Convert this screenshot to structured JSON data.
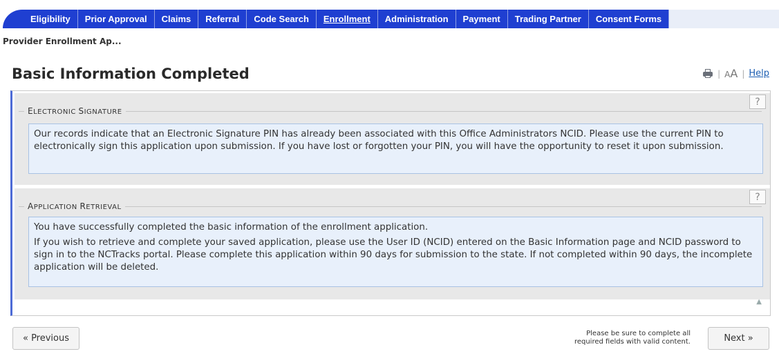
{
  "nav": {
    "tabs": [
      {
        "label": "Eligibility"
      },
      {
        "label": "Prior Approval"
      },
      {
        "label": "Claims"
      },
      {
        "label": "Referral"
      },
      {
        "label": "Code Search"
      },
      {
        "label": "Enrollment"
      },
      {
        "label": "Administration"
      },
      {
        "label": "Payment"
      },
      {
        "label": "Trading Partner"
      },
      {
        "label": "Consent Forms"
      }
    ],
    "active": "Enrollment"
  },
  "breadcrumb": "Provider Enrollment Ap...",
  "page": {
    "title": "Basic Information Completed",
    "text_size_label": "AA",
    "help_label": "Help"
  },
  "sections": {
    "electronic_signature": {
      "legend": "Electronic Signature",
      "help": "?",
      "text": "Our records indicate that an Electronic Signature PIN has already been associated with this Office Administrators NCID. Please use the current PIN to electronically sign this application upon submission. If you have lost or forgotten your PIN, you will have the opportunity to reset it upon submission."
    },
    "application_retrieval": {
      "legend": "Application Retrieval",
      "help": "?",
      "text1": "You have successfully completed the basic information of the enrollment application.",
      "text2": "If you wish to retrieve and complete your saved application, please use the User ID (NCID) entered on the Basic Information page and NCID password to sign in to the NCTracks portal. Please complete this application within 90 days for submission to the state. If not completed within 90 days, the incomplete application will be deleted."
    }
  },
  "footer": {
    "previous_label": "« Previous",
    "next_label": "Next »",
    "note_line1": "Please be sure to complete all",
    "note_line2": "required fields with valid content."
  },
  "colors": {
    "nav_tab": "#1f3fd1",
    "panel_accent": "#4d6bd6",
    "info_box": "#e8f0fb"
  }
}
